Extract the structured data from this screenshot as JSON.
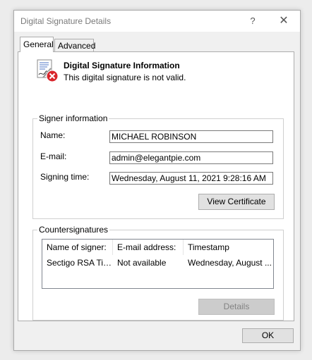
{
  "window": {
    "title": "Digital Signature Details",
    "help_glyph": "?",
    "close_glyph": "✕"
  },
  "tabs": [
    {
      "label": "General"
    },
    {
      "label": "Advanced"
    }
  ],
  "general": {
    "heading": "Digital Signature Information",
    "status": "This digital signature is not valid.",
    "signer_group": {
      "label": "Signer information",
      "name_label": "Name:",
      "name_value": "MICHAEL ROBINSON",
      "email_label": "E-mail:",
      "email_value": "admin@elegantpie.com",
      "time_label": "Signing time:",
      "time_value": "Wednesday, August 11, 2021 9:28:16 AM",
      "view_certificate": "View Certificate"
    },
    "countersignatures": {
      "label": "Countersignatures",
      "columns": [
        "Name of signer:",
        "E-mail address:",
        "Timestamp"
      ],
      "rows": [
        [
          "Sectigo RSA Tim...",
          "Not available",
          "Wednesday, August ..."
        ]
      ],
      "details_button": "Details"
    }
  },
  "footer": {
    "ok_label": "OK"
  },
  "colors": {
    "error": "#d9252b"
  }
}
